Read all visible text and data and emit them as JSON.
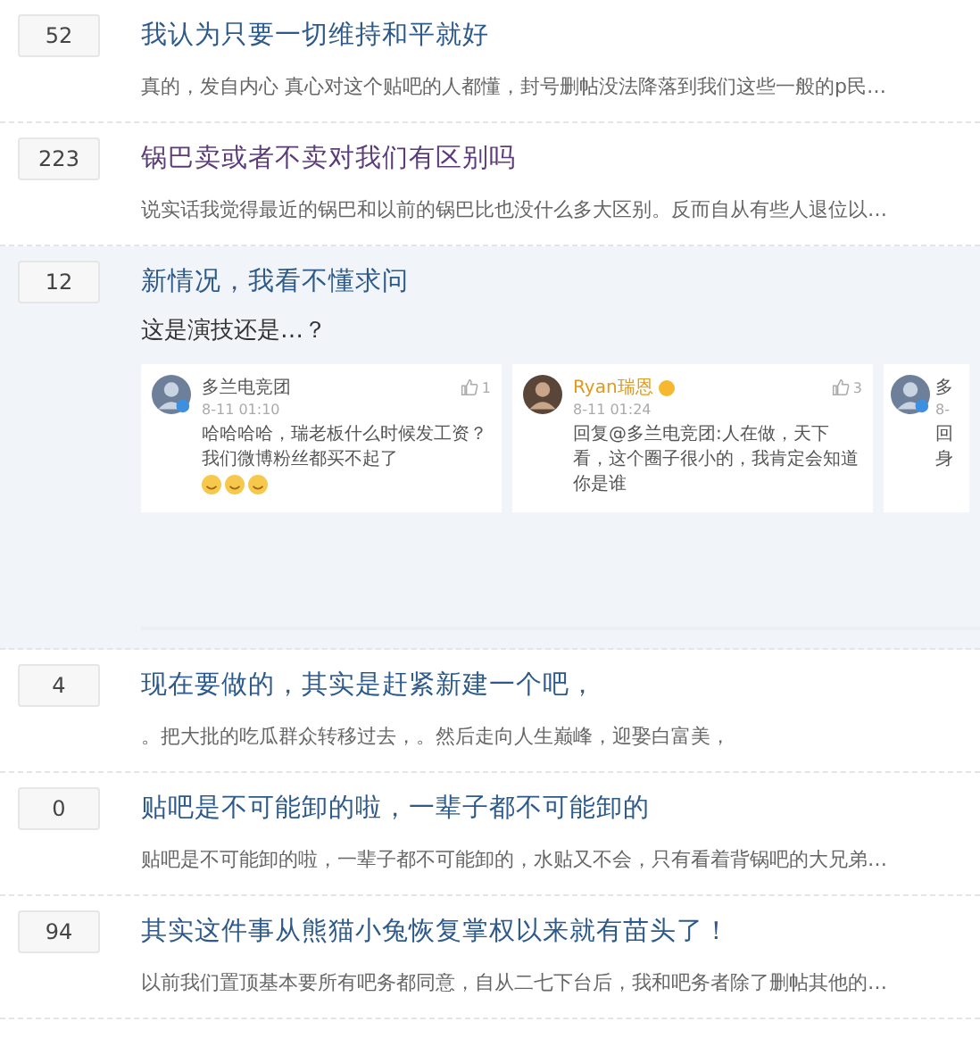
{
  "threads": [
    {
      "replies": "52",
      "title": "我认为只要一切维持和平就好",
      "visited": false,
      "highlighted": false,
      "excerpt": "真的，发自内心 真心对这个贴吧的人都懂，封号删帖没法降落到我们这些一般的p民…"
    },
    {
      "replies": "223",
      "title": "锅巴卖或者不卖对我们有区别吗",
      "visited": true,
      "highlighted": false,
      "excerpt": "说实话我觉得最近的锅巴和以前的锅巴比也没什么多大区别。反而自从有些人退位以…"
    },
    {
      "replies": "12",
      "title": "新情况，我看不懂求问",
      "visited": false,
      "highlighted": true,
      "body": "这是演技还是…？",
      "comments": [
        {
          "user": "多兰电竞团",
          "time": "8-11 01:10",
          "likes": "1",
          "text": "哈哈哈哈，瑞老板什么时候发工资？我们微博粉丝都买不起了",
          "emojis": [
            {
              "kind": "grin"
            },
            {
              "kind": "grin"
            },
            {
              "kind": "grin"
            }
          ],
          "badge": false
        },
        {
          "user": "Ryan瑞恩",
          "time": "8-11 01:24",
          "likes": "3",
          "text": "回复@多兰电竞团:人在做，天下看，这个圈子很小的，我肯定会知道你是谁",
          "badge": true
        },
        {
          "user": "多",
          "time": "8-",
          "text": "回身",
          "badge": false
        }
      ]
    },
    {
      "replies": "4",
      "title": "现在要做的，其实是赶紧新建一个吧，",
      "visited": false,
      "highlighted": false,
      "excerpt": "。把大批的吃瓜群众转移过去，。然后走向人生巅峰，迎娶白富美，"
    },
    {
      "replies": "0",
      "title": "贴吧是不可能卸的啦，一辈子都不可能卸的",
      "visited": false,
      "highlighted": false,
      "excerpt": "贴吧是不可能卸的啦，一辈子都不可能卸的，水贴又不会，只有看着背锅吧的大兄弟…"
    },
    {
      "replies": "94",
      "title": "其实这件事从熊猫小兔恢复掌权以来就有苗头了！",
      "visited": false,
      "highlighted": false,
      "excerpt": "以前我们置顶基本要所有吧务都同意，自从二七下台后，我和吧务者除了删帖其他的…"
    }
  ]
}
